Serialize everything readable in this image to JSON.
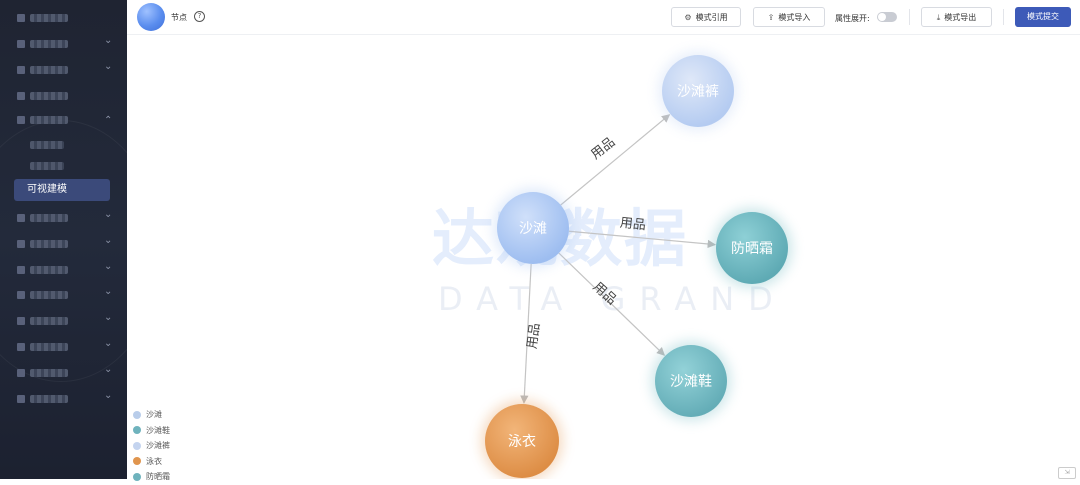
{
  "sidebar": {
    "active_item": "可视建模"
  },
  "toolbar": {
    "node_label": "节点",
    "help_glyph": "?",
    "buttons": {
      "schema_ref": "模式引用",
      "schema_import": "模式导入",
      "schema_export": "模式导出",
      "submit": "模式提交"
    },
    "property_expand_label": "属性展开:",
    "property_expand_on": false
  },
  "graph": {
    "nodes": [
      {
        "id": "beach",
        "label": "沙滩",
        "color": "#a9c6f2"
      },
      {
        "id": "pants",
        "label": "沙滩裤",
        "color": "#bfd3f3"
      },
      {
        "id": "sunscreen",
        "label": "防晒霜",
        "color": "#6fb9c1"
      },
      {
        "id": "shoes",
        "label": "沙滩鞋",
        "color": "#77bcc4"
      },
      {
        "id": "swimsuit",
        "label": "泳衣",
        "color": "#e49a55"
      }
    ],
    "edges": [
      {
        "from": "beach",
        "to": "pants",
        "label": "用品"
      },
      {
        "from": "beach",
        "to": "sunscreen",
        "label": "用品"
      },
      {
        "from": "beach",
        "to": "shoes",
        "label": "用品"
      },
      {
        "from": "beach",
        "to": "swimsuit",
        "label": "用品"
      }
    ]
  },
  "legend": [
    {
      "label": "沙滩",
      "color": "#b9cdea"
    },
    {
      "label": "沙滩鞋",
      "color": "#6fb3bd"
    },
    {
      "label": "沙滩裤",
      "color": "#c4d4ef"
    },
    {
      "label": "泳衣",
      "color": "#e0954e"
    },
    {
      "label": "防晒霜",
      "color": "#6fb3bd"
    }
  ],
  "watermark": {
    "cn": "达观数据",
    "en": "DATA GRAND"
  }
}
